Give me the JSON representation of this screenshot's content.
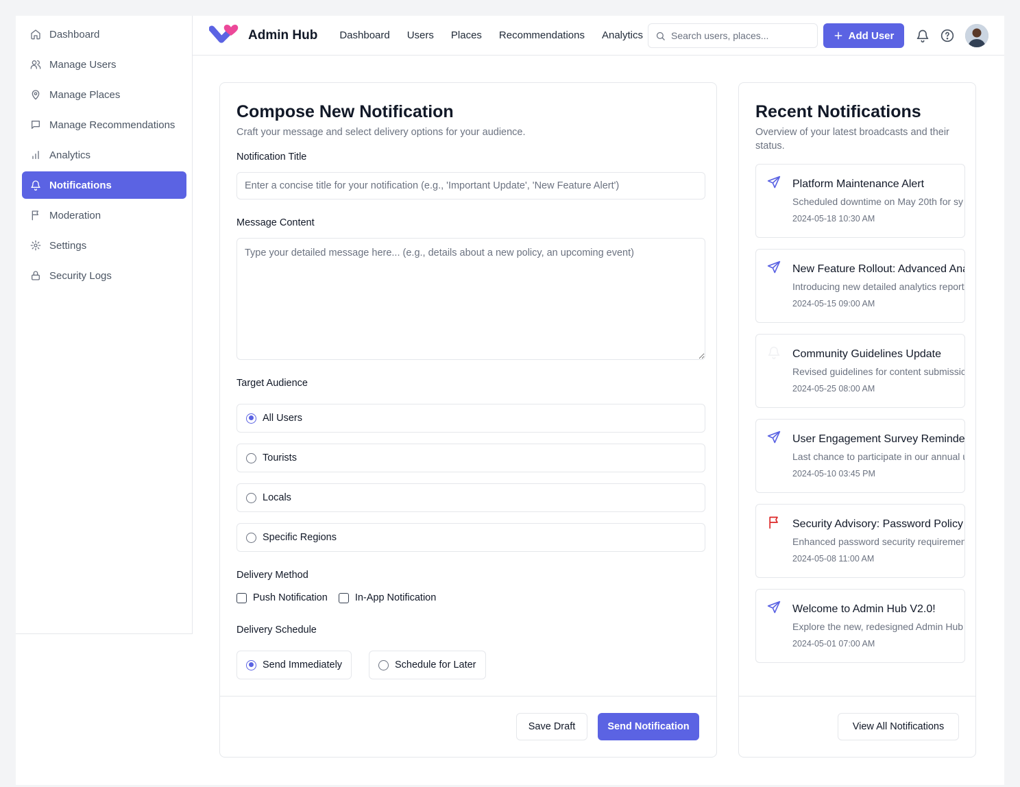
{
  "sidebar": {
    "items": [
      {
        "label": "Dashboard",
        "icon": "home-icon"
      },
      {
        "label": "Manage Users",
        "icon": "users-icon"
      },
      {
        "label": "Manage Places",
        "icon": "map-pin-icon"
      },
      {
        "label": "Manage Recommendations",
        "icon": "message-square-icon"
      },
      {
        "label": "Analytics",
        "icon": "bar-chart-icon"
      },
      {
        "label": "Notifications",
        "icon": "bell-icon",
        "active": true
      },
      {
        "label": "Moderation",
        "icon": "flag-icon"
      },
      {
        "label": "Settings",
        "icon": "gear-icon"
      },
      {
        "label": "Security Logs",
        "icon": "lock-icon"
      }
    ]
  },
  "header": {
    "brand": "Admin Hub",
    "nav": [
      "Dashboard",
      "Users",
      "Places",
      "Recommendations",
      "Analytics"
    ],
    "search_placeholder": "Search users, places...",
    "add_user_label": "Add User",
    "accent_color": "#5b63e3"
  },
  "compose": {
    "title": "Compose New Notification",
    "subtitle": "Craft your message and select delivery options for your audience.",
    "title_label": "Notification Title",
    "title_placeholder": "Enter a concise title for your notification (e.g., 'Important Update', 'New Feature Alert')",
    "message_label": "Message Content",
    "message_placeholder": "Type your detailed message here... (e.g., details about a new policy, an upcoming event)",
    "audience_label": "Target Audience",
    "audience_options": [
      {
        "label": "All Users",
        "selected": true
      },
      {
        "label": "Tourists",
        "selected": false
      },
      {
        "label": "Locals",
        "selected": false
      },
      {
        "label": "Specific Regions",
        "selected": false
      }
    ],
    "delivery_label": "Delivery Method",
    "delivery_options": [
      {
        "label": "Push Notification",
        "checked": false
      },
      {
        "label": "In-App Notification",
        "checked": false
      }
    ],
    "schedule_label": "Delivery Schedule",
    "schedule_options": [
      {
        "label": "Send Immediately",
        "selected": true
      },
      {
        "label": "Schedule for Later",
        "selected": false
      }
    ],
    "save_draft_label": "Save Draft",
    "send_label": "Send Notification"
  },
  "recent": {
    "title": "Recent Notifications",
    "subtitle": "Overview of your latest broadcasts and their status.",
    "items": [
      {
        "icon": "send-icon",
        "title": "Platform Maintenance Alert",
        "desc": "Scheduled downtime on May 20th for sy",
        "time": "2024-05-18 10:30 AM"
      },
      {
        "icon": "send-icon",
        "title": "New Feature Rollout: Advanced Ana",
        "desc": "Introducing new detailed analytics report",
        "time": "2024-05-15 09:00 AM"
      },
      {
        "icon": "bell-icon",
        "title": "Community Guidelines Update",
        "desc": "Revised guidelines for content submissic",
        "time": "2024-05-25 08:00 AM"
      },
      {
        "icon": "send-icon",
        "title": "User Engagement Survey Reminder",
        "desc": "Last chance to participate in our annual u",
        "time": "2024-05-10 03:45 PM"
      },
      {
        "icon": "flag-icon",
        "title": "Security Advisory: Password Policy",
        "desc": "Enhanced password security requiremen",
        "time": "2024-05-08 11:00 AM"
      },
      {
        "icon": "send-icon",
        "title": "Welcome to Admin Hub V2.0!",
        "desc": "Explore the new, redesigned Admin Hub",
        "time": "2024-05-01 07:00 AM"
      }
    ],
    "view_all_label": "View All Notifications"
  }
}
